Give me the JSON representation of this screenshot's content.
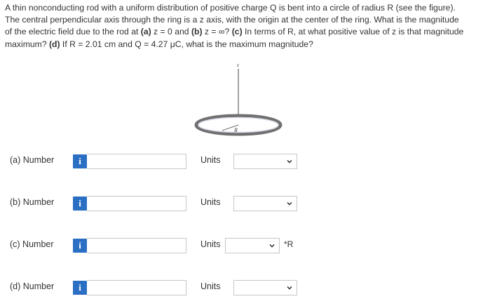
{
  "question": {
    "line1": "A thin nonconducting rod with a uniform distribution of positive charge Q is bent into a circle of radius R (see the figure).",
    "line2": "The central perpendicular axis through the ring is a z axis, with the origin at the center of the ring. What is the magnitude",
    "line3_a": "of the electric field due to the rod at ",
    "line3_b": "(a)",
    "line3_c": " z = 0 and ",
    "line3_d": "(b)",
    "line3_e": " z = ∞? ",
    "line3_f": "(c)",
    "line3_g": " In terms of R, at what positive value of z is that magnitude",
    "line4_a": "maximum? ",
    "line4_b": "(d)",
    "line4_c": " If R = 2.01 cm and Q = 4.27 μC, what is the maximum magnitude?"
  },
  "figure": {
    "axis_label": "z",
    "radius_label": "R"
  },
  "rows": [
    {
      "label": "(a)   Number",
      "info": "i",
      "value": "",
      "units_label": "Units",
      "suffix": ""
    },
    {
      "label": "(b)   Number",
      "info": "i",
      "value": "",
      "units_label": "Units",
      "suffix": ""
    },
    {
      "label": "(c)   Number",
      "info": "i",
      "value": "",
      "units_label": "Units",
      "suffix": "*R"
    },
    {
      "label": "(d)   Number",
      "info": "i",
      "value": "",
      "units_label": "Units",
      "suffix": ""
    }
  ],
  "colors": {
    "info_button": "#2b6fc4",
    "ring": "#707070",
    "ring_inner": "#d8dde8"
  }
}
